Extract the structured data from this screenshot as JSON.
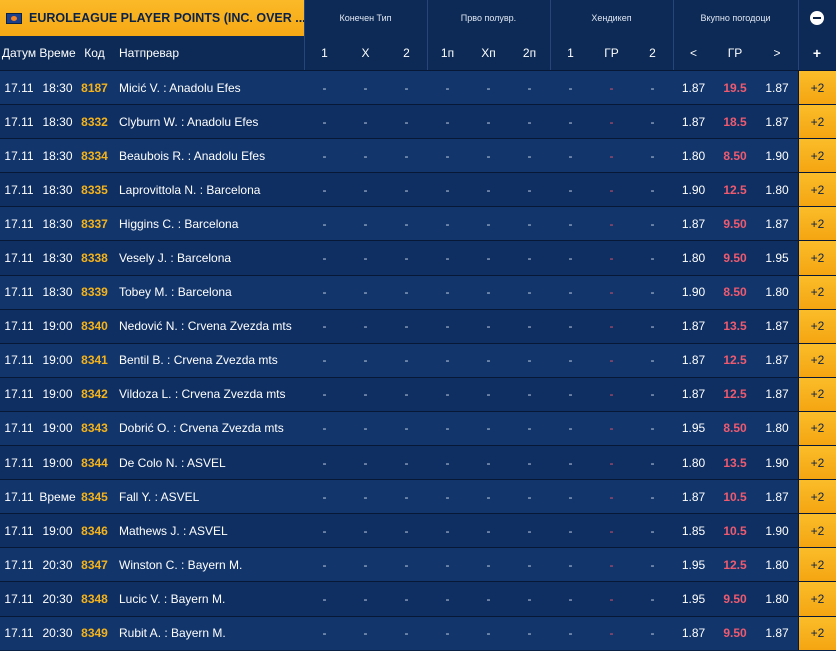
{
  "header": {
    "title": "EUROLEAGUE PLAYER POINTS (INC. OVER ...",
    "flag_icon": "euroleague-flag-icon",
    "groups": [
      "Конечен Тип",
      "Прво полувр.",
      "Хендикеп",
      "Вкупно погодоци"
    ],
    "columns": {
      "date": "Датум",
      "time": "Време",
      "code": "Код",
      "match": "Натпревар",
      "ft1": "1",
      "ftx": "X",
      "ft2": "2",
      "h1": "1п",
      "hx": "Хп",
      "h2": "2п",
      "hc1": "1",
      "hcgr": "ГР",
      "hc2": "2",
      "under": "<",
      "gr": "ГР",
      "over": ">",
      "plus": "+"
    }
  },
  "colors": {
    "accent": "#f6a814",
    "background": "#0b2247",
    "line": "#ef5a6f"
  },
  "rows": [
    {
      "date": "17.11",
      "time": "18:30",
      "code": "8187",
      "match": "Micić V. : Anadolu Efes",
      "ft1": "-",
      "ftx": "-",
      "ft2": "-",
      "h1": "-",
      "hx": "-",
      "h2": "-",
      "hc1": "-",
      "hcgr": "-",
      "hc2": "-",
      "under": "1.87",
      "line": "19.5",
      "over": "1.87",
      "more": "+2"
    },
    {
      "date": "17.11",
      "time": "18:30",
      "code": "8332",
      "match": "Clyburn W. : Anadolu Efes",
      "ft1": "-",
      "ftx": "-",
      "ft2": "-",
      "h1": "-",
      "hx": "-",
      "h2": "-",
      "hc1": "-",
      "hcgr": "-",
      "hc2": "-",
      "under": "1.87",
      "line": "18.5",
      "over": "1.87",
      "more": "+2"
    },
    {
      "date": "17.11",
      "time": "18:30",
      "code": "8334",
      "match": "Beaubois R. : Anadolu Efes",
      "ft1": "-",
      "ftx": "-",
      "ft2": "-",
      "h1": "-",
      "hx": "-",
      "h2": "-",
      "hc1": "-",
      "hcgr": "-",
      "hc2": "-",
      "under": "1.80",
      "line": "8.50",
      "over": "1.90",
      "more": "+2"
    },
    {
      "date": "17.11",
      "time": "18:30",
      "code": "8335",
      "match": "Laprovittola N. : Barcelona",
      "ft1": "-",
      "ftx": "-",
      "ft2": "-",
      "h1": "-",
      "hx": "-",
      "h2": "-",
      "hc1": "-",
      "hcgr": "-",
      "hc2": "-",
      "under": "1.90",
      "line": "12.5",
      "over": "1.80",
      "more": "+2"
    },
    {
      "date": "17.11",
      "time": "18:30",
      "code": "8337",
      "match": "Higgins C. : Barcelona",
      "ft1": "-",
      "ftx": "-",
      "ft2": "-",
      "h1": "-",
      "hx": "-",
      "h2": "-",
      "hc1": "-",
      "hcgr": "-",
      "hc2": "-",
      "under": "1.87",
      "line": "9.50",
      "over": "1.87",
      "more": "+2"
    },
    {
      "date": "17.11",
      "time": "18:30",
      "code": "8338",
      "match": "Vesely J. : Barcelona",
      "ft1": "-",
      "ftx": "-",
      "ft2": "-",
      "h1": "-",
      "hx": "-",
      "h2": "-",
      "hc1": "-",
      "hcgr": "-",
      "hc2": "-",
      "under": "1.80",
      "line": "9.50",
      "over": "1.95",
      "more": "+2"
    },
    {
      "date": "17.11",
      "time": "18:30",
      "code": "8339",
      "match": "Tobey M. : Barcelona",
      "ft1": "-",
      "ftx": "-",
      "ft2": "-",
      "h1": "-",
      "hx": "-",
      "h2": "-",
      "hc1": "-",
      "hcgr": "-",
      "hc2": "-",
      "under": "1.90",
      "line": "8.50",
      "over": "1.80",
      "more": "+2"
    },
    {
      "date": "17.11",
      "time": "19:00",
      "code": "8340",
      "match": "Nedović N. : Crvena Zvezda mts",
      "ft1": "-",
      "ftx": "-",
      "ft2": "-",
      "h1": "-",
      "hx": "-",
      "h2": "-",
      "hc1": "-",
      "hcgr": "-",
      "hc2": "-",
      "under": "1.87",
      "line": "13.5",
      "over": "1.87",
      "more": "+2"
    },
    {
      "date": "17.11",
      "time": "19:00",
      "code": "8341",
      "match": "Bentil B. : Crvena Zvezda mts",
      "ft1": "-",
      "ftx": "-",
      "ft2": "-",
      "h1": "-",
      "hx": "-",
      "h2": "-",
      "hc1": "-",
      "hcgr": "-",
      "hc2": "-",
      "under": "1.87",
      "line": "12.5",
      "over": "1.87",
      "more": "+2"
    },
    {
      "date": "17.11",
      "time": "19:00",
      "code": "8342",
      "match": "Vildoza L. : Crvena Zvezda mts",
      "ft1": "-",
      "ftx": "-",
      "ft2": "-",
      "h1": "-",
      "hx": "-",
      "h2": "-",
      "hc1": "-",
      "hcgr": "-",
      "hc2": "-",
      "under": "1.87",
      "line": "12.5",
      "over": "1.87",
      "more": "+2"
    },
    {
      "date": "17.11",
      "time": "19:00",
      "code": "8343",
      "match": "Dobrić O. : Crvena Zvezda mts",
      "ft1": "-",
      "ftx": "-",
      "ft2": "-",
      "h1": "-",
      "hx": "-",
      "h2": "-",
      "hc1": "-",
      "hcgr": "-",
      "hc2": "-",
      "under": "1.95",
      "line": "8.50",
      "over": "1.80",
      "more": "+2"
    },
    {
      "date": "17.11",
      "time": "19:00",
      "code": "8344",
      "match": "De Colo N. : ASVEL",
      "ft1": "-",
      "ftx": "-",
      "ft2": "-",
      "h1": "-",
      "hx": "-",
      "h2": "-",
      "hc1": "-",
      "hcgr": "-",
      "hc2": "-",
      "under": "1.80",
      "line": "13.5",
      "over": "1.90",
      "more": "+2"
    },
    {
      "date": "17.11",
      "time": "Време",
      "code": "8345",
      "match": "Fall Y. : ASVEL",
      "ft1": "-",
      "ftx": "-",
      "ft2": "-",
      "h1": "-",
      "hx": "-",
      "h2": "-",
      "hc1": "-",
      "hcgr": "-",
      "hc2": "-",
      "under": "1.87",
      "line": "10.5",
      "over": "1.87",
      "more": "+2"
    },
    {
      "date": "17.11",
      "time": "19:00",
      "code": "8346",
      "match": "Mathews J. : ASVEL",
      "ft1": "-",
      "ftx": "-",
      "ft2": "-",
      "h1": "-",
      "hx": "-",
      "h2": "-",
      "hc1": "-",
      "hcgr": "-",
      "hc2": "-",
      "under": "1.85",
      "line": "10.5",
      "over": "1.90",
      "more": "+2"
    },
    {
      "date": "17.11",
      "time": "20:30",
      "code": "8347",
      "match": "Winston C. : Bayern M.",
      "ft1": "-",
      "ftx": "-",
      "ft2": "-",
      "h1": "-",
      "hx": "-",
      "h2": "-",
      "hc1": "-",
      "hcgr": "-",
      "hc2": "-",
      "under": "1.95",
      "line": "12.5",
      "over": "1.80",
      "more": "+2"
    },
    {
      "date": "17.11",
      "time": "20:30",
      "code": "8348",
      "match": "Lucic V. : Bayern M.",
      "ft1": "-",
      "ftx": "-",
      "ft2": "-",
      "h1": "-",
      "hx": "-",
      "h2": "-",
      "hc1": "-",
      "hcgr": "-",
      "hc2": "-",
      "under": "1.95",
      "line": "9.50",
      "over": "1.80",
      "more": "+2"
    },
    {
      "date": "17.11",
      "time": "20:30",
      "code": "8349",
      "match": "Rubit A. : Bayern M.",
      "ft1": "-",
      "ftx": "-",
      "ft2": "-",
      "h1": "-",
      "hx": "-",
      "h2": "-",
      "hc1": "-",
      "hcgr": "-",
      "hc2": "-",
      "under": "1.87",
      "line": "9.50",
      "over": "1.87",
      "more": "+2"
    }
  ]
}
